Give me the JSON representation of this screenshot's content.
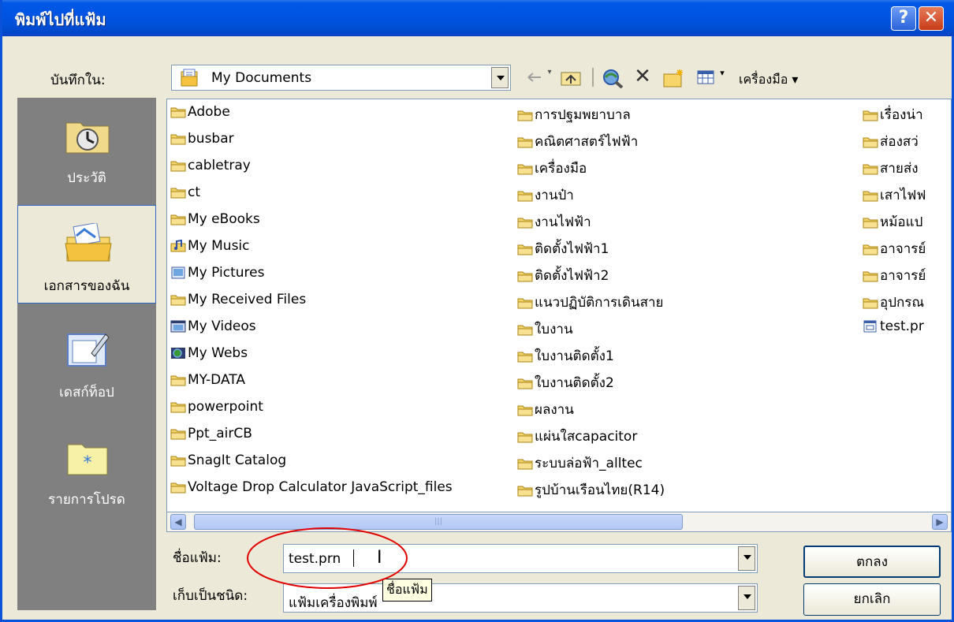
{
  "window": {
    "title": "พิมพ์ไปที่แฟ้ม"
  },
  "titlebar": {
    "help": "?",
    "close": "✕"
  },
  "location": {
    "label": "บันทึกใน:",
    "value": "My Documents"
  },
  "toolbar": {
    "tools_label": "เครื่องมือ ▾"
  },
  "places": [
    {
      "label": "ประวัติ",
      "icon": "history-icon"
    },
    {
      "label": "เอกสารของฉัน",
      "icon": "my-documents-icon"
    },
    {
      "label": "เดสก์ท็อป",
      "icon": "desktop-icon"
    },
    {
      "label": "รายการโปรด",
      "icon": "favorites-icon"
    }
  ],
  "files": {
    "col1": [
      {
        "name": "Adobe",
        "icon": "folder"
      },
      {
        "name": "busbar",
        "icon": "folder"
      },
      {
        "name": "cabletray",
        "icon": "folder"
      },
      {
        "name": "ct",
        "icon": "folder"
      },
      {
        "name": "My eBooks",
        "icon": "folder"
      },
      {
        "name": "My Music",
        "icon": "music-folder"
      },
      {
        "name": "My Pictures",
        "icon": "pictures-folder"
      },
      {
        "name": "My Received Files",
        "icon": "folder"
      },
      {
        "name": "My Videos",
        "icon": "videos-folder"
      },
      {
        "name": "My Webs",
        "icon": "webs-folder"
      },
      {
        "name": "MY-DATA",
        "icon": "folder"
      },
      {
        "name": "powerpoint",
        "icon": "folder"
      },
      {
        "name": "Ppt_airCB",
        "icon": "folder"
      },
      {
        "name": "SnagIt Catalog",
        "icon": "folder"
      },
      {
        "name": "Voltage Drop Calculator JavaScript_files",
        "icon": "folder"
      }
    ],
    "col2": [
      {
        "name": "การปฐมพยาบาล",
        "icon": "folder"
      },
      {
        "name": "คณิตศาสตร์ไฟฟ้า",
        "icon": "folder"
      },
      {
        "name": "เครื่องมือ",
        "icon": "folder"
      },
      {
        "name": "งานป๋า",
        "icon": "folder"
      },
      {
        "name": "งานไฟฟ้า",
        "icon": "folder"
      },
      {
        "name": "ติดตั้งไฟฟ้า1",
        "icon": "folder"
      },
      {
        "name": "ติดตั้งไฟฟ้า2",
        "icon": "folder"
      },
      {
        "name": "แนวปฏิบัติการเดินสาย",
        "icon": "folder"
      },
      {
        "name": "ใบงาน",
        "icon": "folder"
      },
      {
        "name": "ใบงานติดตั้ง1",
        "icon": "folder"
      },
      {
        "name": "ใบงานติดตั้ง2",
        "icon": "folder"
      },
      {
        "name": "ผลงาน",
        "icon": "folder"
      },
      {
        "name": "แผ่นใสcapacitor",
        "icon": "folder"
      },
      {
        "name": "ระบบล่อฟ้า_alltec",
        "icon": "folder"
      },
      {
        "name": "รูปบ้านเรือนไทย(R14)",
        "icon": "folder"
      }
    ],
    "col3": [
      {
        "name": "เรื่องน่า",
        "icon": "folder"
      },
      {
        "name": "ส่องสว่",
        "icon": "folder"
      },
      {
        "name": "สายส่ง",
        "icon": "folder"
      },
      {
        "name": "เสาไฟฟ",
        "icon": "folder"
      },
      {
        "name": "หม้อแป",
        "icon": "folder"
      },
      {
        "name": "อาจารย์",
        "icon": "folder"
      },
      {
        "name": "อาจารย์",
        "icon": "folder"
      },
      {
        "name": "อุปกรณ",
        "icon": "folder"
      },
      {
        "name": "test.pr",
        "icon": "file"
      }
    ]
  },
  "filename": {
    "label": "ชื่อแฟ้ม:",
    "value": "test.prn"
  },
  "filetype": {
    "label": "เก็บเป็นชนิด:",
    "value": "แฟ้มเครื่องพิมพ์"
  },
  "tooltip": "ชื่อแฟ้ม",
  "buttons": {
    "ok": "ตกลง",
    "cancel": "ยกเลิก"
  },
  "colors": {
    "titlebar": "#0054e3",
    "face": "#ece9d8",
    "highlight_ring": "#e00000"
  }
}
